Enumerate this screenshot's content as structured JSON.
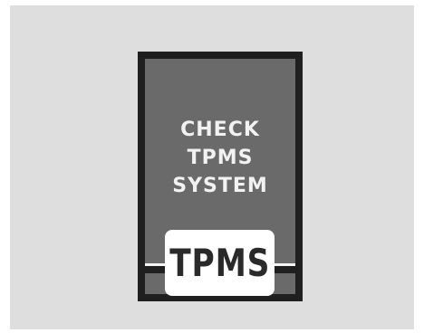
{
  "warning_display": {
    "message": "CHECK\nTPMS\nSYSTEM",
    "indicator_label": "TPMS"
  },
  "colors": {
    "page_background": "#dedede",
    "display_frame": "#1f1f1f",
    "display_screen": "#6a6a6a",
    "text_light": "#f2f2f2",
    "badge_background": "#ffffff",
    "badge_text": "#2a2a2a"
  }
}
